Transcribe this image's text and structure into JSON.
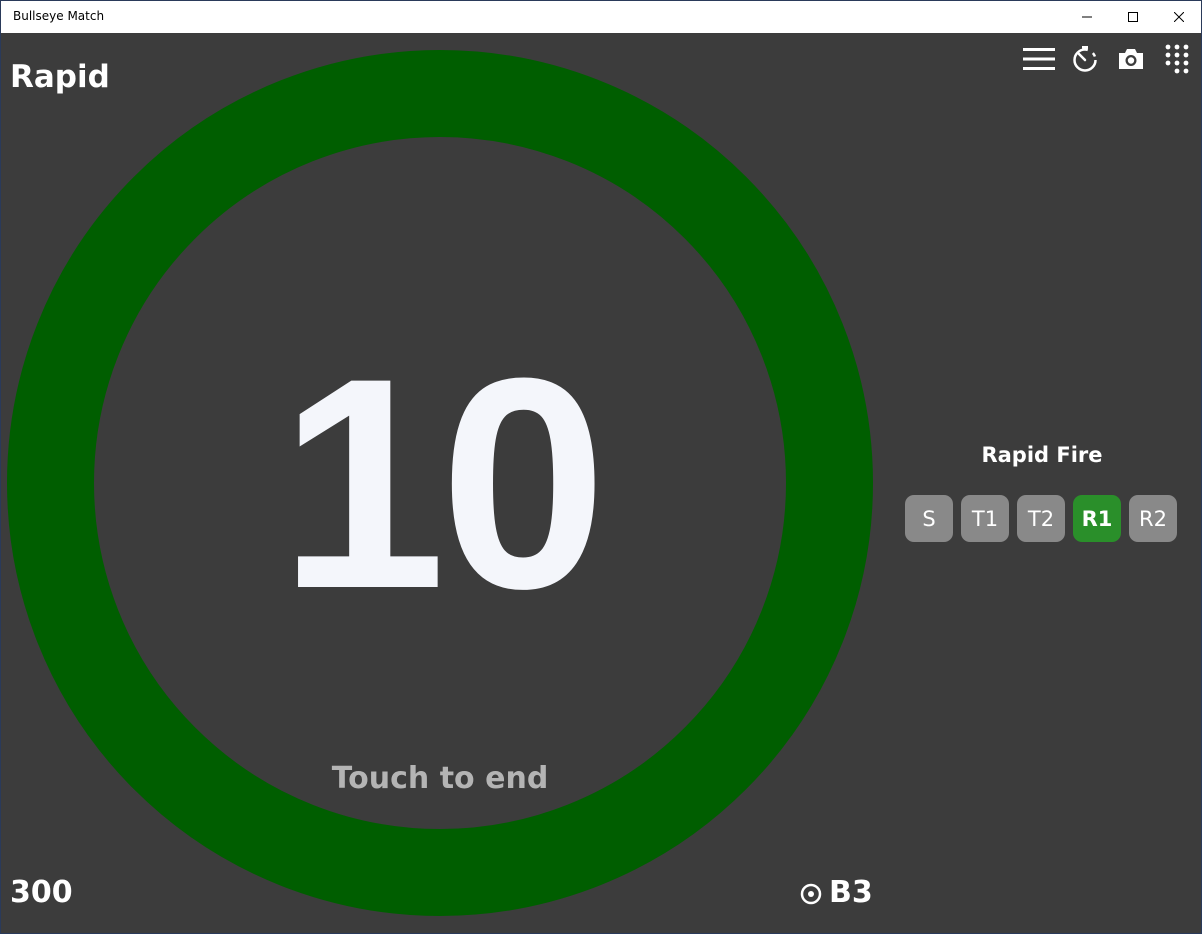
{
  "window": {
    "title": "Bullseye Match"
  },
  "header": {
    "mode": "Rapid"
  },
  "toolbar": {
    "icons": [
      "menu-icon",
      "timer-icon",
      "camera-icon",
      "keypad-icon"
    ]
  },
  "timer": {
    "value": "10",
    "hint": "Touch to end",
    "ring_color": "#005e00"
  },
  "stage": {
    "label": "Rapid Fire",
    "buttons": [
      {
        "label": "S",
        "active": false
      },
      {
        "label": "T1",
        "active": false
      },
      {
        "label": "T2",
        "active": false
      },
      {
        "label": "R1",
        "active": true
      },
      {
        "label": "R2",
        "active": false
      }
    ],
    "active_color": "#2a8f2a",
    "inactive_color": "#898989"
  },
  "footer": {
    "score": "300",
    "target": "B3",
    "target_icon": "target-icon"
  }
}
